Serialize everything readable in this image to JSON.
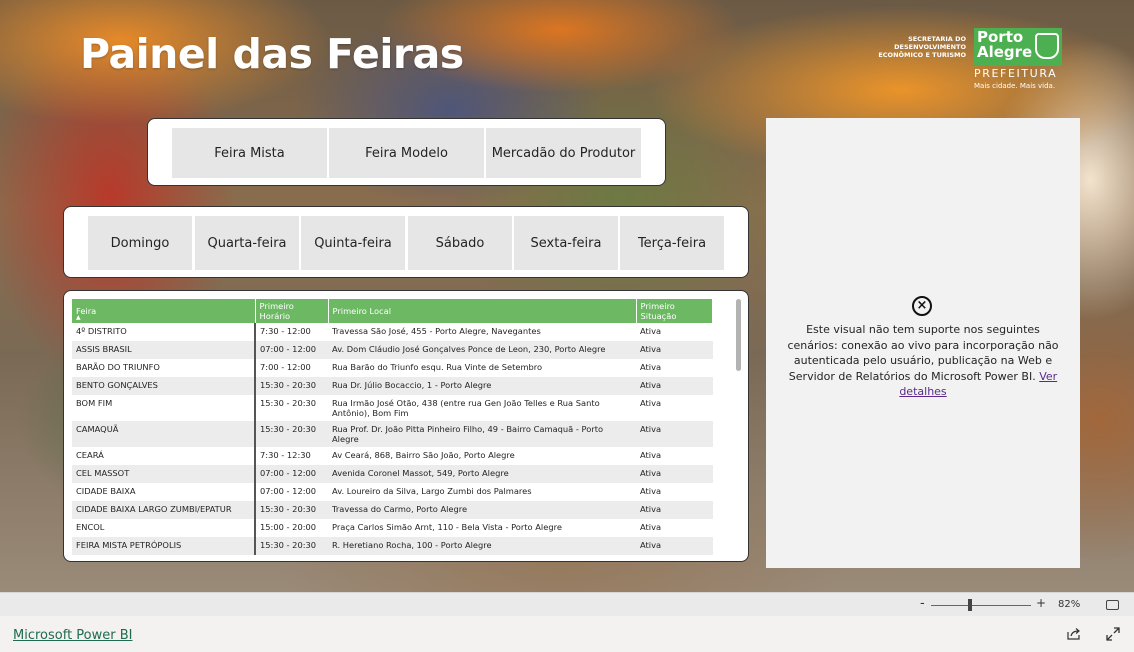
{
  "report": {
    "title": "Painel das Feiras",
    "logo": {
      "secretaria_lines": [
        "SECRETARIA DO",
        "DESENVOLVIMENTO",
        "ECONÔMICO E TURISMO"
      ],
      "porto_lines": [
        "Porto",
        "Alegre"
      ],
      "prefeitura": "PREFEITURA",
      "motto": "Mais cidade. Mais vida."
    }
  },
  "slicer_tipo": {
    "items": [
      "Feira Mista",
      "Feira Modelo",
      "Mercadão do Produtor"
    ]
  },
  "slicer_dia": {
    "items": [
      "Domingo",
      "Quarta-feira",
      "Quinta-feira",
      "Sábado",
      "Sexta-feira",
      "Terça-feira"
    ]
  },
  "table": {
    "headers": [
      "Feira",
      "Primeiro Horário",
      "Primeiro Local",
      "Primeiro Situação"
    ],
    "rows": [
      [
        "4º DISTRITO",
        "7:30 - 12:00",
        "Travessa São José, 455 - Porto Alegre, Navegantes",
        "Ativa"
      ],
      [
        "ASSIS BRASIL",
        "07:00 - 12:00",
        "Av. Dom Cláudio José Gonçalves Ponce de Leon, 230, Porto Alegre",
        "Ativa"
      ],
      [
        "BARÃO DO TRIUNFO",
        "7:00 - 12:00",
        "Rua Barão do Triunfo esqu. Rua Vinte de Setembro",
        "Ativa"
      ],
      [
        "BENTO GONÇALVES",
        "15:30 - 20:30",
        "Rua Dr. Júlio Bocaccio, 1 - Porto Alegre",
        "Ativa"
      ],
      [
        "BOM FIM",
        "15:30 - 20:30",
        "Rua Irmão José Otão, 438 (entre rua Gen João Telles e Rua Santo Antônio), Bom Fim",
        "Ativa"
      ],
      [
        "CAMAQUÃ",
        "15:30 - 20:30",
        "Rua Prof. Dr. João Pitta Pinheiro Filho, 49 - Bairro Camaquã - Porto Alegre",
        "Ativa"
      ],
      [
        "CEARÁ",
        "7:30 - 12:30",
        "Av Ceará, 868, Bairro São João, Porto Alegre",
        "Ativa"
      ],
      [
        "CEL MASSOT",
        "07:00 - 12:00",
        "Avenida Coronel Massot, 549, Porto Alegre",
        "Ativa"
      ],
      [
        "CIDADE BAIXA",
        "07:00 - 12:00",
        "Av. Loureiro da Silva, Largo Zumbi dos Palmares",
        "Ativa"
      ],
      [
        "CIDADE BAIXA LARGO ZUMBI/EPATUR",
        "15:30 - 20:30",
        "Travessa do Carmo, Porto Alegre",
        "Ativa"
      ],
      [
        "ENCOL",
        "15:00 - 20:00",
        "Praça Carlos Simão Arnt, 110 - Bela Vista - Porto Alegre",
        "Ativa"
      ],
      [
        "FEIRA MISTA PETRÓPOLIS",
        "15:30 - 20:30",
        "R. Heretiano Rocha, 100 - Porto Alegre",
        "Ativa"
      ]
    ]
  },
  "unsupported": {
    "message": "Este visual não tem suporte nos seguintes cenários: conexão ao vivo para incorporação não autenticada pelo usuário, publicação na Web e Servidor de Relatórios do Microsoft Power BI.",
    "link": "Ver detalhes"
  },
  "zoom": {
    "minus": "-",
    "plus": "+",
    "value": "82%"
  },
  "footer": {
    "brand": "Microsoft Power BI"
  }
}
